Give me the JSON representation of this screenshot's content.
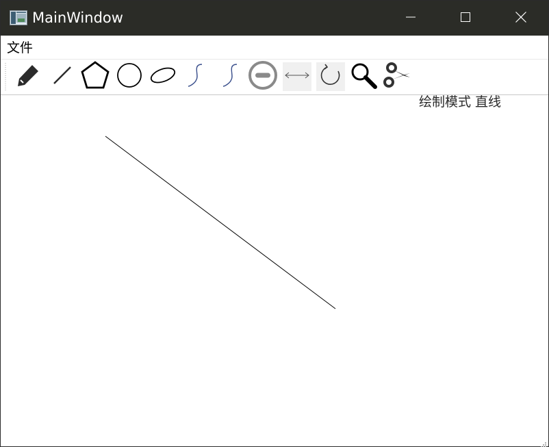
{
  "window": {
    "title": "MainWindow",
    "icon": "app-window-icon",
    "controls": [
      "minimize-icon",
      "maximize-icon",
      "close-icon"
    ]
  },
  "menubar": {
    "items": [
      {
        "label": "文件"
      }
    ]
  },
  "toolbar": {
    "tools": [
      {
        "name": "pencil",
        "icon": "pencil-icon"
      },
      {
        "name": "line",
        "icon": "line-icon"
      },
      {
        "name": "polygon",
        "icon": "pentagon-icon"
      },
      {
        "name": "circle",
        "icon": "circle-icon"
      },
      {
        "name": "ellipse",
        "icon": "ellipse-icon"
      },
      {
        "name": "curve-1",
        "icon": "curve-icon"
      },
      {
        "name": "curve-2",
        "icon": "curve-icon"
      },
      {
        "name": "delete",
        "icon": "minus-circle-icon"
      },
      {
        "name": "translate",
        "icon": "double-arrow-icon",
        "checked": true
      },
      {
        "name": "rotate",
        "icon": "rotate-icon",
        "checked": true
      },
      {
        "name": "scale",
        "icon": "magnifier-icon"
      },
      {
        "name": "clip",
        "icon": "scissors-icon"
      }
    ]
  },
  "canvas": {
    "status": "绘制模式 直线",
    "stroke_color": "#000000",
    "background": "#ffffff"
  },
  "colors": {
    "titlebar": "#2b2c27",
    "toolbar_checked": "#f0f0f0",
    "curve_stroke": "#3a4f8c"
  }
}
